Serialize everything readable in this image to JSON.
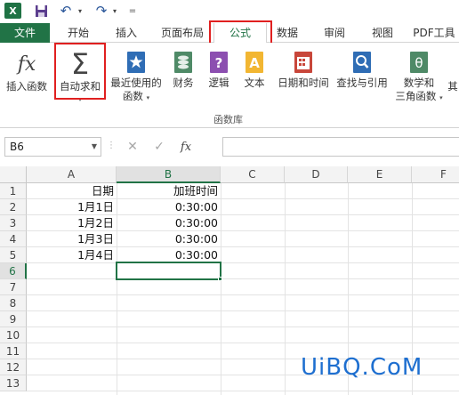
{
  "quick_access": {
    "app_logo_text": "X",
    "undo_arrow": "▾",
    "redo_arrow": "▾",
    "customize": "="
  },
  "tabs": [
    {
      "label": "文件"
    },
    {
      "label": "开始"
    },
    {
      "label": "插入"
    },
    {
      "label": "页面布局"
    },
    {
      "label": "公式",
      "active": true
    },
    {
      "label": "数据"
    },
    {
      "label": "审阅"
    },
    {
      "label": "视图"
    },
    {
      "label": "PDF工具"
    }
  ],
  "ribbon": {
    "insert_function": "插入函数",
    "autosum": "自动求和",
    "recently_used_l1": "最近使用的",
    "recently_used_l2": "函数",
    "financial": "财务",
    "logical": "逻辑",
    "text": "文本",
    "date_time": "日期和时间",
    "lookup": "查找与引用",
    "math_l1": "数学和",
    "math_l2": "三角函数",
    "more": "其",
    "group_label": "函数库",
    "dropdown": "▾"
  },
  "formula_bar": {
    "name_box": "B6",
    "cancel": "✕",
    "enter": "✓",
    "fx": "fx",
    "value": ""
  },
  "sheet": {
    "columns": [
      "A",
      "B",
      "C",
      "D",
      "E",
      "F"
    ],
    "rows": [
      "1",
      "2",
      "3",
      "4",
      "5",
      "6",
      "7",
      "8",
      "9",
      "10",
      "11",
      "12",
      "13"
    ],
    "selected_cell": "B6",
    "cells": {
      "A1": "日期",
      "B1": "加班时间",
      "A2": "1月1日",
      "B2": "0:30:00",
      "A3": "1月2日",
      "B3": "0:30:00",
      "A4": "1月3日",
      "B4": "0:30:00",
      "A5": "1月4日",
      "B5": "0:30:00"
    }
  },
  "watermark": "UiBQ.CoM",
  "colors": {
    "excel_green": "#217346",
    "highlight_red": "#e02020",
    "watermark_blue": "#1e6fd0"
  }
}
